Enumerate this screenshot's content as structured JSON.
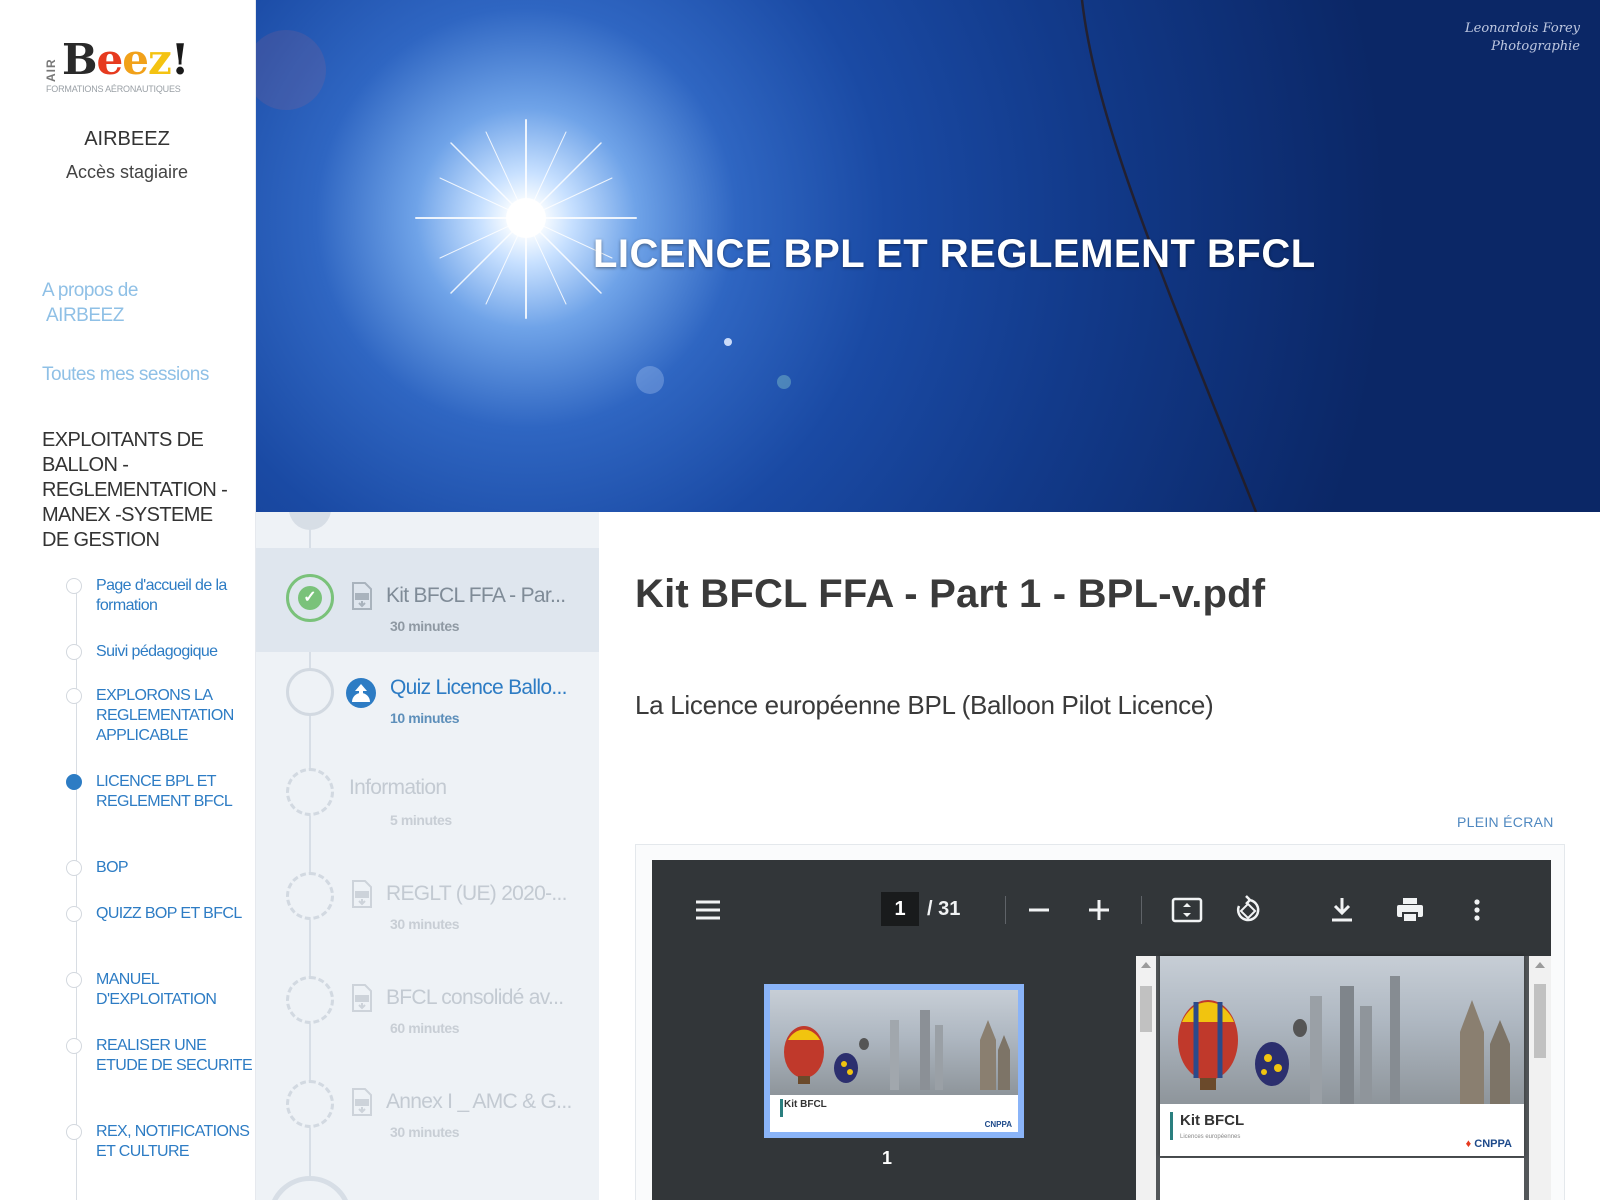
{
  "sidebar": {
    "logo": {
      "air": "AIR",
      "brand": "Beez!",
      "tagline": "FORMATIONS AÉRONAUTIQUES"
    },
    "org_name": "AIRBEEZ",
    "access_label": "Accès stagiaire",
    "links": {
      "about_line1": "A propos de",
      "about_line2": "AIRBEEZ",
      "sessions": "Toutes mes sessions"
    },
    "section_title": "EXPLOITANTS DE BALLON - REGLEMENTATION -MANEX -SYSTEME DE GESTION",
    "steps": [
      {
        "label": "Page d'accueil de la formation",
        "active": false
      },
      {
        "label": "Suivi pédagogique",
        "active": false
      },
      {
        "label": "EXPLORONS LA REGLEMENTATION APPLICABLE",
        "active": false
      },
      {
        "label": "LICENCE BPL ET REGLEMENT BFCL",
        "active": true
      },
      {
        "label": "BOP",
        "active": false
      },
      {
        "label": "QUIZZ BOP ET BFCL",
        "active": false
      },
      {
        "label": "MANUEL D'EXPLOITATION",
        "active": false
      },
      {
        "label": "REALISER UNE ETUDE DE SECURITE",
        "active": false
      },
      {
        "label": "REX, NOTIFICATIONS ET CULTURE",
        "active": false
      }
    ]
  },
  "hero": {
    "title": "LICENCE BPL ET REGLEMENT BFCL",
    "credit_line1": "Leonardois Forey",
    "credit_line2": "Photographie"
  },
  "lessons": [
    {
      "title": "Kit BFCL FFA - Par...",
      "duration": "30 minutes",
      "status": "completed",
      "icon": "pdf-document-icon"
    },
    {
      "title": "Quiz Licence Ballo...",
      "duration": "10 minutes",
      "status": "available",
      "icon": "quiz-icon"
    },
    {
      "title": "Information",
      "duration": "5 minutes",
      "status": "locked",
      "icon": "none"
    },
    {
      "title": "REGLT (UE) 2020-...",
      "duration": "30 minutes",
      "status": "locked",
      "icon": "pdf-document-icon"
    },
    {
      "title": "BFCL consolidé av...",
      "duration": "60 minutes",
      "status": "locked",
      "icon": "pdf-document-icon"
    },
    {
      "title": "Annex I _ AMC & G...",
      "duration": "30 minutes",
      "status": "locked",
      "icon": "pdf-document-icon"
    }
  ],
  "content": {
    "title": "Kit BFCL FFA - Part 1 - BPL-v.pdf",
    "description": "La Licence européenne BPL (Balloon Pilot Licence)",
    "fullscreen_label": "PLEIN ÉCRAN"
  },
  "pdf_viewer": {
    "current_page": "1",
    "total_pages": "/ 31",
    "thumbnail_page_number": "1",
    "slide_title": "Kit BFCL",
    "slide_subtitle": "Licences européennes",
    "slide_logo": "CNPPA"
  },
  "colors": {
    "link_blue": "#2d7cc4",
    "light_link": "#8fc0e6",
    "completed_green": "#7ac27a",
    "lesson_panel_bg": "#eef2f6",
    "pdf_toolbar": "#323639"
  }
}
